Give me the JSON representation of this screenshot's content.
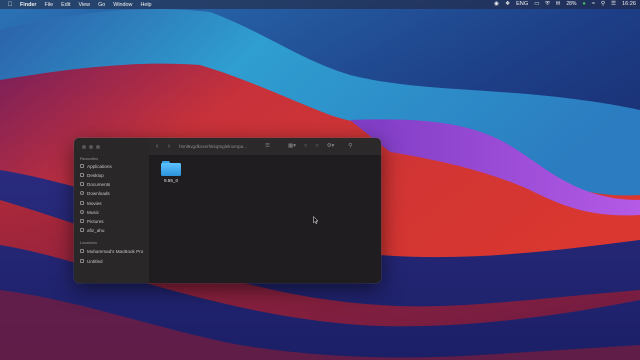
{
  "menubar": {
    "app_name": "Finder",
    "items": [
      "File",
      "Edit",
      "View",
      "Go",
      "Window",
      "Help"
    ],
    "battery_percent": "28%",
    "clock": "16:26",
    "status_icons": [
      "screen-record-icon",
      "dropbox-icon",
      "keyboard-input-icon",
      "airplay-icon",
      "shield-icon",
      "mail-icon",
      "battery-icon",
      "wifi-icon",
      "search-icon",
      "control-center-icon"
    ],
    "input_label": "ENG"
  },
  "finder": {
    "title": "html5vgdkvxerhkkqtnglelnxmpa...",
    "sidebar": {
      "favorites_label": "Favourites",
      "favorites": [
        {
          "label": "Applications",
          "icon": "applications-icon"
        },
        {
          "label": "Desktop",
          "icon": "desktop-icon"
        },
        {
          "label": "Documents",
          "icon": "documents-icon"
        },
        {
          "label": "Downloads",
          "icon": "downloads-icon"
        },
        {
          "label": "Movies",
          "icon": "movies-icon"
        },
        {
          "label": "Music",
          "icon": "music-icon"
        },
        {
          "label": "Pictures",
          "icon": "pictures-icon"
        },
        {
          "label": "afiz_ahu",
          "icon": "home-icon"
        }
      ],
      "locations_label": "Locations",
      "locations": [
        {
          "label": "Muhammad's MacBook Pro",
          "icon": "laptop-icon"
        },
        {
          "label": "Untitled",
          "icon": "disk-icon"
        }
      ]
    },
    "items": [
      {
        "name": "9.55_0",
        "type": "folder"
      }
    ]
  },
  "colors": {
    "folder": "#4fb4f5",
    "window_bg": "#1f1d20",
    "sidebar_bg": "#2a2729"
  }
}
